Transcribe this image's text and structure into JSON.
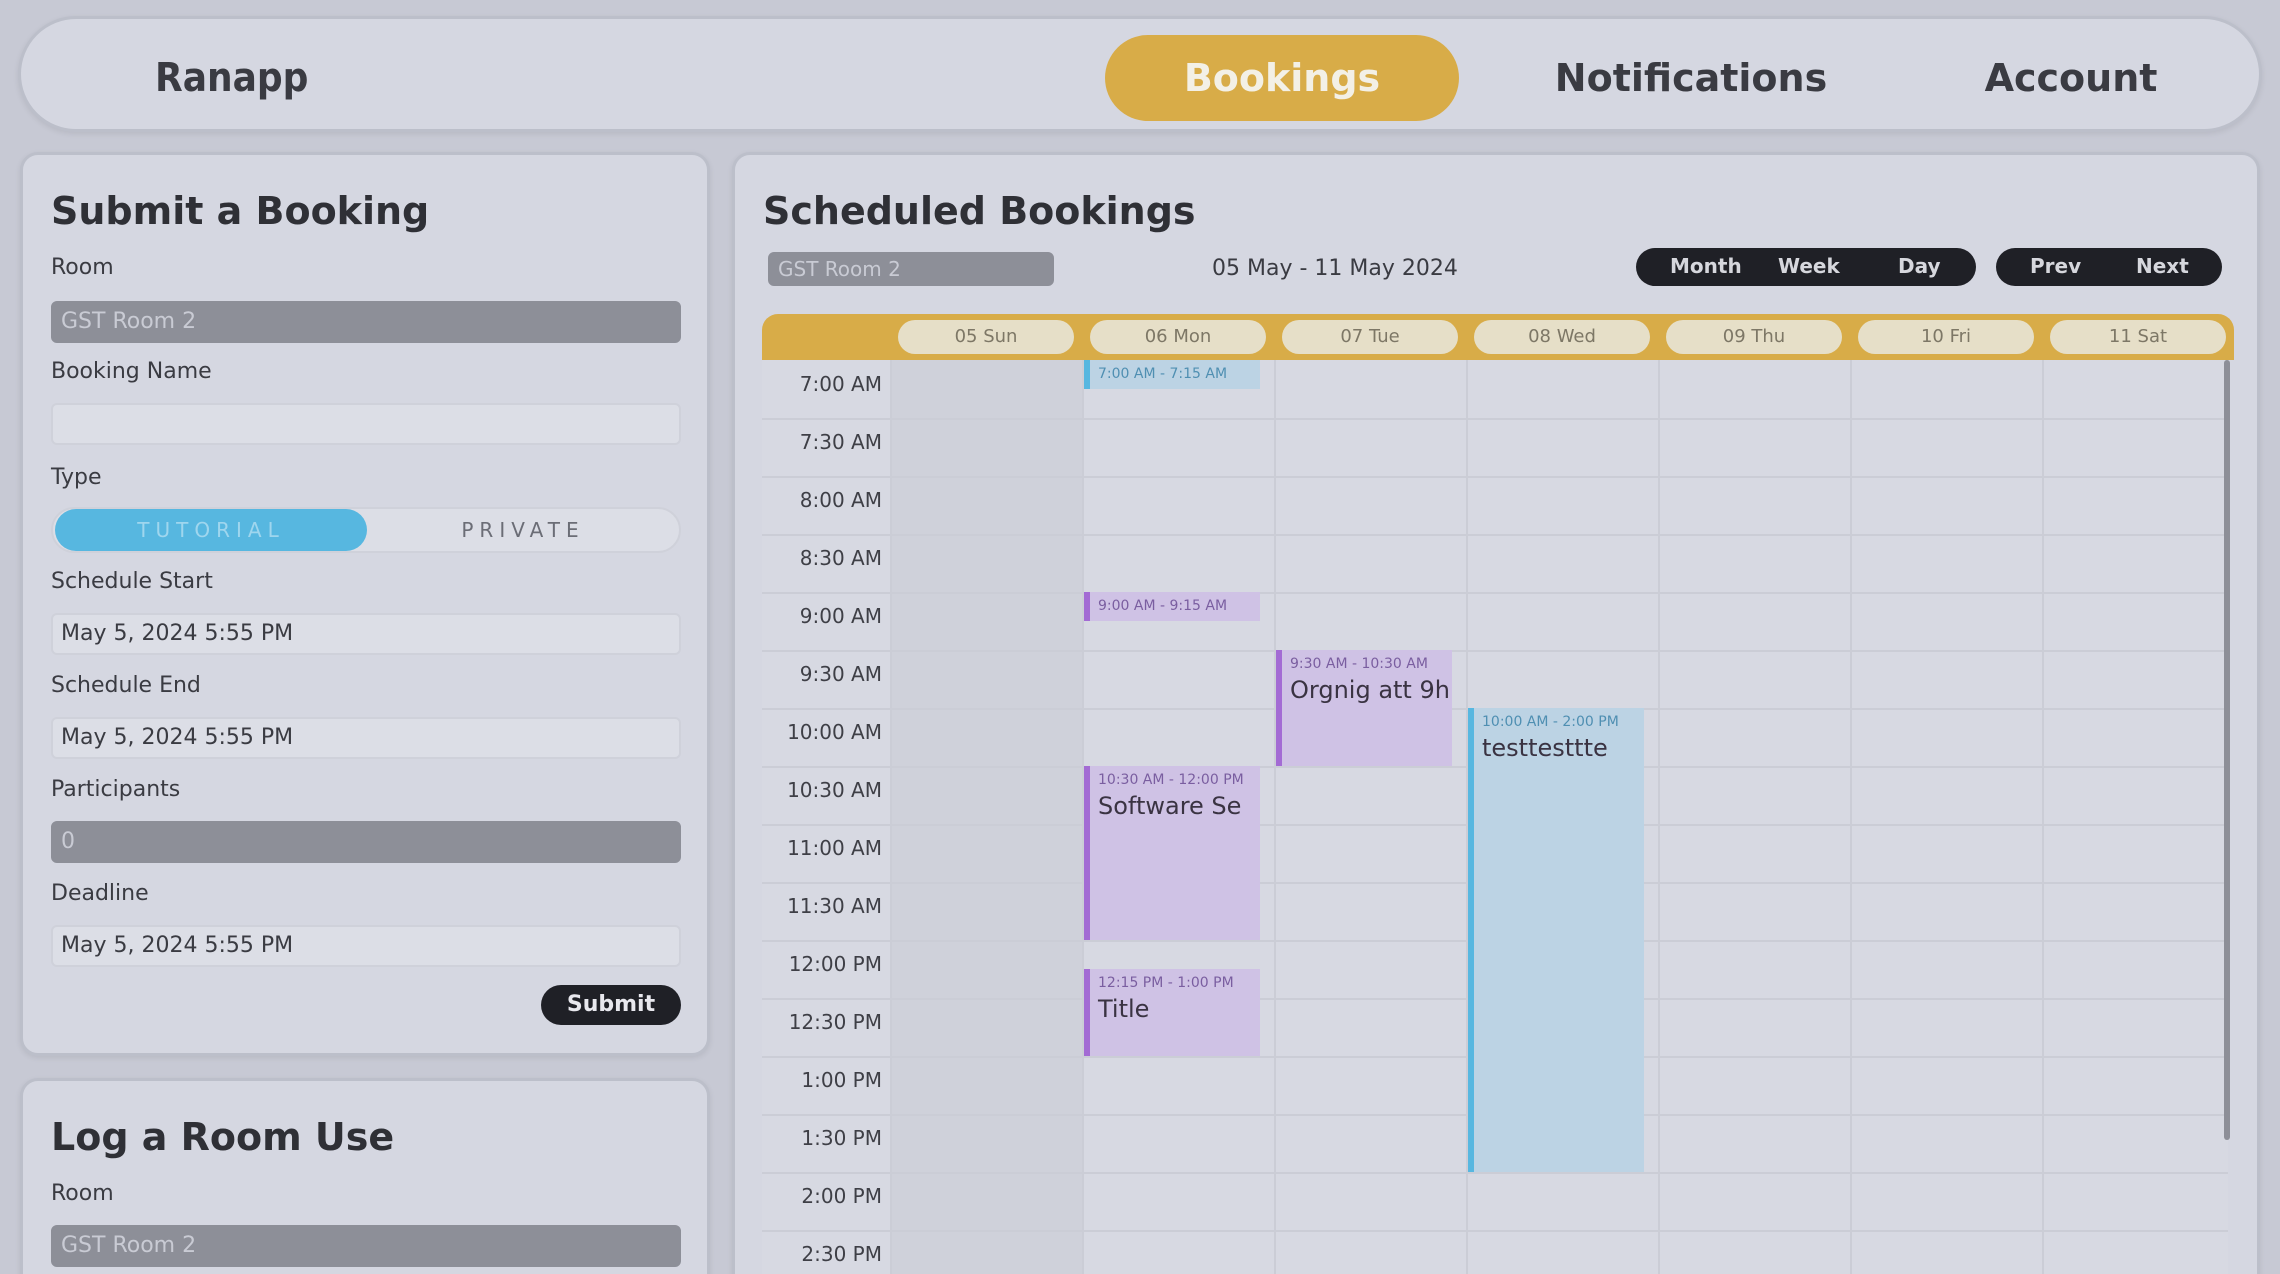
{
  "nav": {
    "brand": "Ranapp",
    "tabs": [
      {
        "label": "Bookings",
        "active": true
      },
      {
        "label": "Notifications",
        "active": false
      },
      {
        "label": "Account",
        "active": false
      }
    ]
  },
  "submit_form": {
    "title": "Submit a Booking",
    "room_label": "Room",
    "room_value": "GST Room 2",
    "booking_name_label": "Booking Name",
    "booking_name_value": "",
    "type_label": "Type",
    "type_options": [
      "TUTORIAL",
      "PRIVATE"
    ],
    "type_selected": "TUTORIAL",
    "schedule_start_label": "Schedule Start",
    "schedule_start_value": "May 5, 2024 5:55 PM",
    "schedule_end_label": "Schedule End",
    "schedule_end_value": "May 5, 2024 5:55 PM",
    "participants_label": "Participants",
    "participants_value": "0",
    "deadline_label": "Deadline",
    "deadline_value": "May 5, 2024 5:55 PM",
    "submit_label": "Submit"
  },
  "log_form": {
    "title": "Log a Room Use",
    "room_label": "Room",
    "room_value": "GST Room 2"
  },
  "calendar": {
    "title": "Scheduled Bookings",
    "room_filter": "GST Room 2",
    "date_range": "05 May - 11 May 2024",
    "view_buttons": [
      "Month",
      "Week",
      "Day"
    ],
    "nav_buttons": [
      "Prev",
      "Next"
    ],
    "days": [
      "05 Sun",
      "06 Mon",
      "07 Tue",
      "08 Wed",
      "09 Thu",
      "10 Fri",
      "11 Sat"
    ],
    "times": [
      "7:00 AM",
      "7:30 AM",
      "8:00 AM",
      "8:30 AM",
      "9:00 AM",
      "9:30 AM",
      "10:00 AM",
      "10:30 AM",
      "11:00 AM",
      "11:30 AM",
      "12:00 PM",
      "12:30 PM",
      "1:00 PM",
      "1:30 PM",
      "2:00 PM",
      "2:30 PM"
    ],
    "events": [
      {
        "day": 1,
        "start": 7.0,
        "end": 7.25,
        "time": "7:00 AM - 7:15 AM",
        "title": "",
        "color": "blue"
      },
      {
        "day": 1,
        "start": 9.0,
        "end": 9.25,
        "time": "9:00 AM - 9:15 AM",
        "title": "",
        "color": "purple"
      },
      {
        "day": 2,
        "start": 9.5,
        "end": 10.5,
        "time": "9:30 AM - 10:30 AM",
        "title": "Orgnig att 9h",
        "color": "purple"
      },
      {
        "day": 3,
        "start": 10.0,
        "end": 14.0,
        "time": "10:00 AM - 2:00 PM",
        "title": "testtesttte",
        "color": "blue"
      },
      {
        "day": 1,
        "start": 10.5,
        "end": 12.0,
        "time": "10:30 AM - 12:00 PM",
        "title": "Software Se",
        "color": "purple"
      },
      {
        "day": 1,
        "start": 12.25,
        "end": 13.0,
        "time": "12:15 PM - 1:00 PM",
        "title": "Title",
        "color": "purple"
      }
    ]
  }
}
